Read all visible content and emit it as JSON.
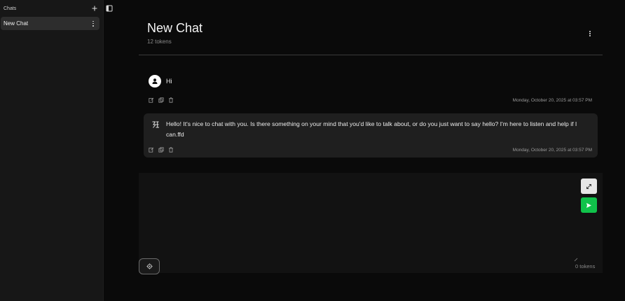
{
  "sidebar": {
    "title": "Chats",
    "items": [
      {
        "label": "New Chat",
        "active": true
      }
    ]
  },
  "header": {
    "title": "New Chat",
    "token_count": "12 tokens"
  },
  "messages": [
    {
      "role": "user",
      "text": "Hi",
      "timestamp": "Monday, October 20, 2025 at 03:57 PM"
    },
    {
      "role": "assistant",
      "text": "Hello! It's nice to chat with you. Is there something on your mind that you'd like to talk about, or do you just want to say hello? I'm here to listen and help if I can.ffd",
      "timestamp": "Monday, October 20, 2025 at 03:57 PM"
    }
  ],
  "composer": {
    "value": "",
    "token_count": "0 tokens"
  },
  "colors": {
    "background": "#0a0a0a",
    "sidebar": "#171717",
    "active_item": "#2d2d2d",
    "assistant_card": "#1f1f1f",
    "send_button": "#10c24a"
  },
  "icons": {
    "new_chat": "plus-icon",
    "sidebar_toggle": "sidebar-panel-icon",
    "user_avatar": "person-icon",
    "assistant_avatar": "ai-logo-icon",
    "edit": "edit-icon",
    "copy": "copy-icon",
    "delete": "trash-icon",
    "expand": "expand-arrows-icon",
    "send": "send-icon",
    "settings": "gear-icon"
  }
}
